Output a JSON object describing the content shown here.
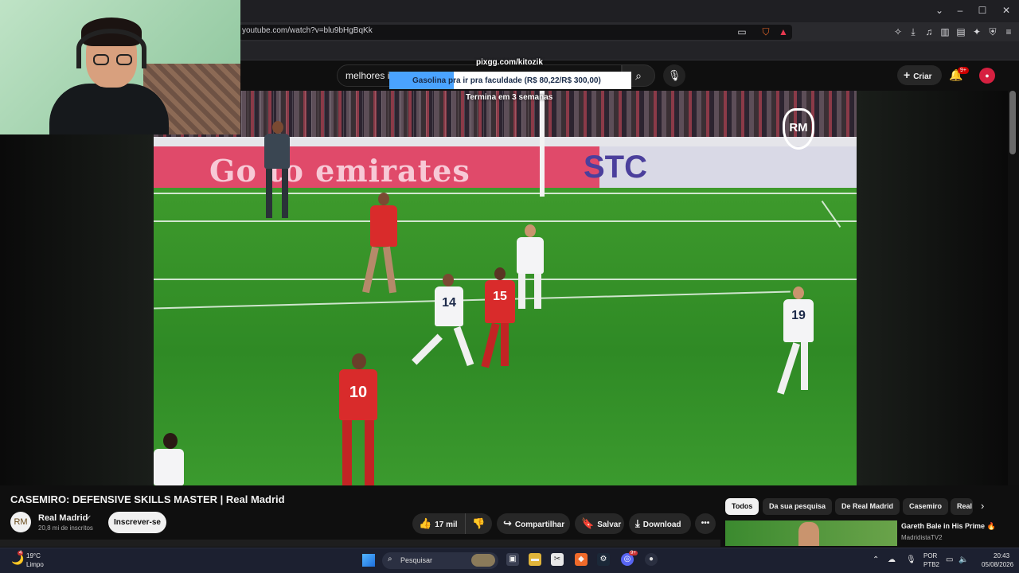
{
  "browser": {
    "url": "youtube.com/watch?v=blu9bHgBqKk",
    "window_controls": {
      "minimize": "–",
      "maximize": "☐",
      "close": "✕",
      "dropdown": "⌄"
    }
  },
  "youtube": {
    "search_query": "melhores in",
    "create_label": "Criar",
    "notifications_badge": "9+",
    "video": {
      "title": "CASEMIRO: DEFENSIVE SKILLS MASTER | Real Madrid",
      "channel": "Real Madrid",
      "subscribers": "20,8 mi de inscritos",
      "subscribe_label": "Inscrever-se",
      "likes": "17 mil",
      "share_label": "Compartilhar",
      "save_label": "Salvar",
      "download_label": "Download",
      "more_label": "•••",
      "board_left": "Go to emirates",
      "board_right": "STC",
      "player_numbers": {
        "p14": "14",
        "p15": "15",
        "p19": "19",
        "p10": "10"
      }
    },
    "chips": [
      "Todos",
      "Da sua pesquisa",
      "De Real Madrid",
      "Casemiro",
      "Real"
    ],
    "recommendation": {
      "title": "Gareth Bale in His Prime 🔥",
      "channel": "MadridistaTV2"
    }
  },
  "donation": {
    "link": "pixgg.com/kitozik",
    "goal_text": "Gasolina pra ir pra faculdade (R$ 80,22/R$ 300,00)",
    "progress": 0.267,
    "ends": "Termina em 3 semanas"
  },
  "taskbar": {
    "weather_temp": "19°C",
    "weather_desc": "Limpo",
    "weather_badge": "4",
    "search_label": "Pesquisar",
    "lang": "POR",
    "kbd": "PTB2",
    "time": "20:43",
    "date": "05/08/2026",
    "discord_badge": "9+"
  },
  "colors": {
    "accent_red": "#cc0000",
    "donation_fill": "#4aa3ff",
    "youtube_bg": "#0f0f0f"
  }
}
